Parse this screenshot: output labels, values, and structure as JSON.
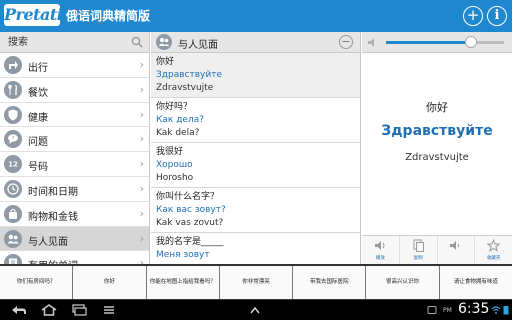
{
  "header": {
    "logo": "Pretati",
    "title": "俄语词典精简版",
    "add_symbol": "+",
    "info_symbol": "i"
  },
  "search": {
    "placeholder": "搜索",
    "icon": "search-icon"
  },
  "categories": [
    {
      "label": "出行",
      "icon": "arrow-turn-icon",
      "selected": false
    },
    {
      "label": "餐饮",
      "icon": "fork-knife-icon",
      "selected": false
    },
    {
      "label": "健康",
      "icon": "shield-icon",
      "selected": false
    },
    {
      "label": "问题",
      "icon": "speech-bubble-icon",
      "selected": false
    },
    {
      "label": "号码",
      "icon": "numbers-icon",
      "selected": false
    },
    {
      "label": "时间和日期",
      "icon": "clock-icon",
      "selected": false
    },
    {
      "label": "购物和金钱",
      "icon": "shopping-bag-icon",
      "selected": false
    },
    {
      "label": "与人见面",
      "icon": "people-icon",
      "selected": true
    },
    {
      "label": "有用的单词",
      "icon": "book-icon",
      "selected": false
    }
  ],
  "phrase_list": {
    "header": "与人见面",
    "collapse_symbol": "−",
    "items": [
      {
        "zh": "你好",
        "ru": "Здравствуйте",
        "translit": "Zdravstvujte"
      },
      {
        "zh": "你好吗？",
        "ru": "Как дела?",
        "translit": "Kak dela?"
      },
      {
        "zh": "我很好",
        "ru": "Хорошо",
        "translit": "Horosho"
      },
      {
        "zh": "你叫什么名字？",
        "ru": "Как вас зовут?",
        "translit": "Kak vas zovut?"
      },
      {
        "zh": "我的名字是_____",
        "ru": "Меня зовут",
        "translit": ""
      }
    ]
  },
  "detail": {
    "volume": 0.72,
    "zh": "你好",
    "ru": "Здравствуйте",
    "translit": "Zdravstvujte",
    "actions": [
      {
        "label": "播放",
        "icon": "speaker-play-icon"
      },
      {
        "label": "复制",
        "icon": "copy-icon"
      },
      {
        "label": "",
        "icon": "speaker-slow-icon"
      },
      {
        "label": "收藏夹",
        "icon": "star-icon"
      }
    ]
  },
  "quick_phrases": [
    "你们有房间吗？",
    "你好",
    "你能在地图上指给我看吗？",
    "你非常漂亮",
    "带我去国际医院",
    "很高兴认识你",
    "请让食物拥有味道"
  ],
  "system_bar": {
    "time": "6:35",
    "ampm": "PM",
    "colors": {
      "accent": "#1f88cf",
      "russian_text": "#1f6fb5"
    }
  }
}
